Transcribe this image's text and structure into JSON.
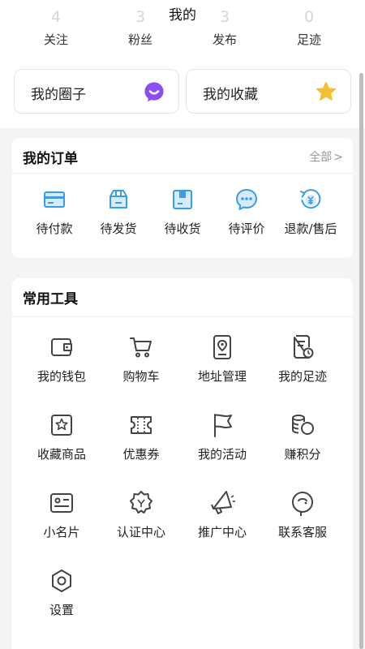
{
  "header": {
    "title": "我的"
  },
  "stats": [
    {
      "value": "4",
      "label": "关注"
    },
    {
      "value": "3",
      "label": "粉丝"
    },
    {
      "value": "3",
      "label": "发布"
    },
    {
      "value": "0",
      "label": "足迹"
    }
  ],
  "cards": {
    "circle": {
      "label": "我的圈子",
      "icon": "chat-bubble-icon",
      "color": "#8b4ef5"
    },
    "favorites": {
      "label": "我的收藏",
      "icon": "star-icon",
      "color": "#f3c034"
    }
  },
  "orders": {
    "title": "我的订单",
    "more_label": "全部",
    "accent": "#3a9be8",
    "items": [
      {
        "label": "待付款",
        "icon": "card-icon"
      },
      {
        "label": "待发货",
        "icon": "shipping-box-icon"
      },
      {
        "label": "待收货",
        "icon": "receive-box-icon"
      },
      {
        "label": "待评价",
        "icon": "comment-icon"
      },
      {
        "label": "退款/售后",
        "icon": "refund-icon"
      }
    ]
  },
  "tools": {
    "title": "常用工具",
    "items": [
      {
        "label": "我的钱包",
        "icon": "wallet-icon"
      },
      {
        "label": "购物车",
        "icon": "cart-icon"
      },
      {
        "label": "地址管理",
        "icon": "location-icon"
      },
      {
        "label": "我的足迹",
        "icon": "footprint-icon"
      },
      {
        "label": "收藏商品",
        "icon": "star-box-icon"
      },
      {
        "label": "优惠券",
        "icon": "coupon-icon"
      },
      {
        "label": "我的活动",
        "icon": "flag-icon"
      },
      {
        "label": "赚积分",
        "icon": "coins-icon"
      },
      {
        "label": "小名片",
        "icon": "id-card-icon"
      },
      {
        "label": "认证中心",
        "icon": "badge-icon"
      },
      {
        "label": "推广中心",
        "icon": "megaphone-icon"
      },
      {
        "label": "联系客服",
        "icon": "customer-service-icon"
      },
      {
        "label": "设置",
        "icon": "settings-icon"
      }
    ]
  }
}
